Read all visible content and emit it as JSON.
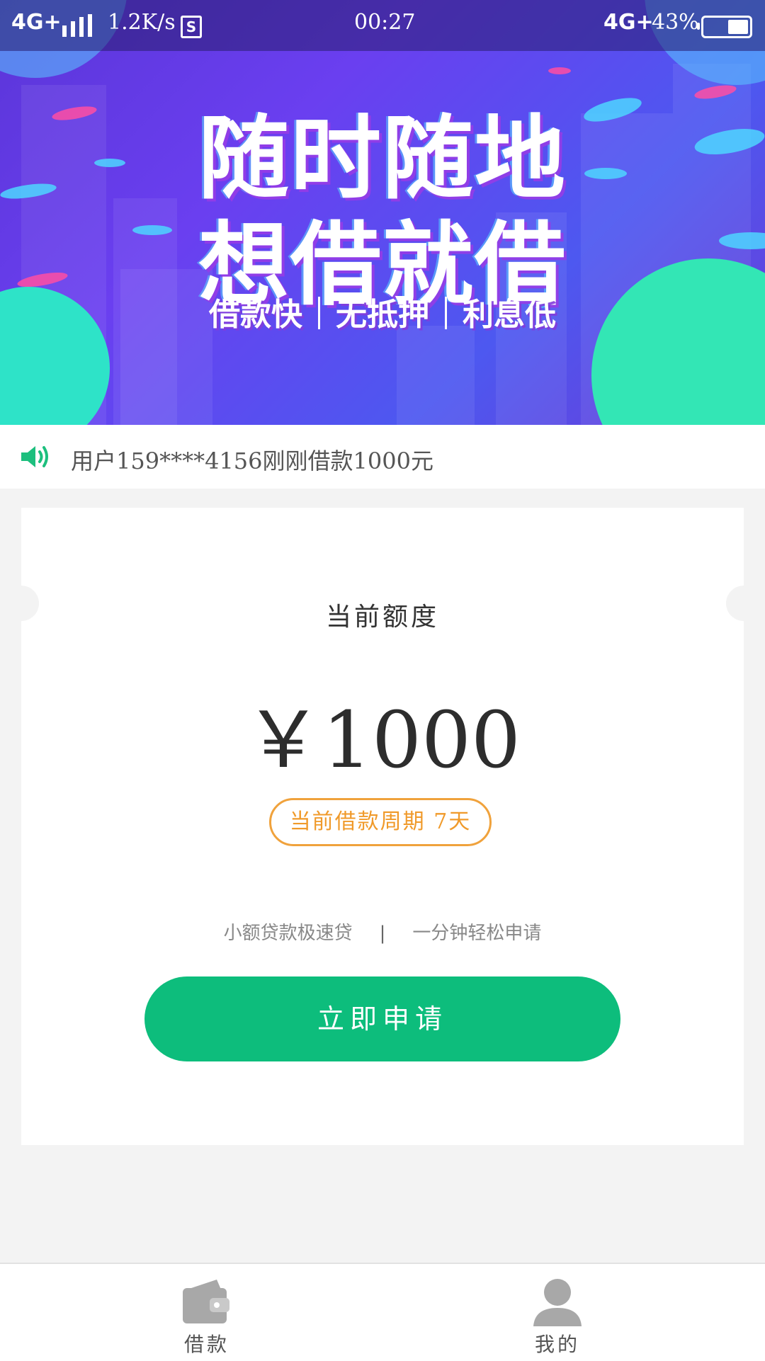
{
  "statusbar": {
    "network": "4G+",
    "speed": "1.2K/s",
    "s_icon": "S",
    "time": "00:27",
    "network2": "4G+",
    "battery": "43%"
  },
  "banner": {
    "title_line1": "随时随地",
    "title_line2": "想借就借",
    "tags": [
      "借款快",
      "无抵押",
      "利息低"
    ]
  },
  "notice": {
    "icon": "speaker-icon",
    "text": "用户159****4156刚刚借款1000元"
  },
  "card": {
    "label": "当前额度",
    "amount": "￥1000",
    "period": "当前借款周期  7天",
    "slogan_left": "小额贷款极速贷",
    "slogan_sep": "|",
    "slogan_right": "一分钟轻松申请",
    "apply_button": "立即申请"
  },
  "tabbar": {
    "items": [
      {
        "label": "借款",
        "icon": "wallet-icon"
      },
      {
        "label": "我的",
        "icon": "user-icon"
      }
    ]
  },
  "colors": {
    "accent": "#0dbd7c",
    "period_border": "#f0a23c",
    "banner_purple": "#6a3ff0"
  }
}
